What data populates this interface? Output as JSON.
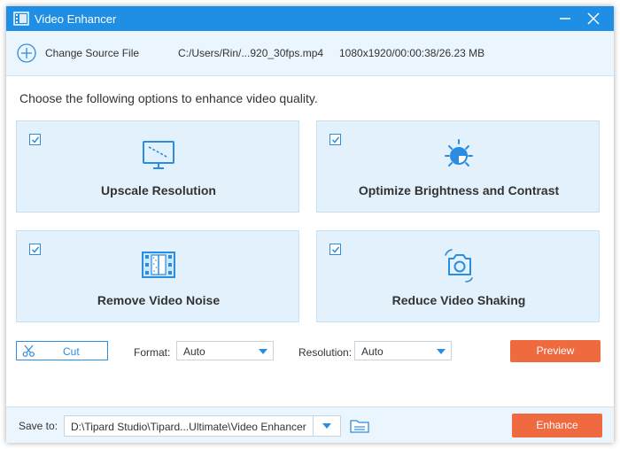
{
  "window": {
    "title": "Video Enhancer",
    "icons": {
      "app": "film-strip-icon",
      "minimize": "minimize-icon",
      "close": "close-icon"
    }
  },
  "source": {
    "change_label": "Change Source File",
    "path": "C:/Users/Rin/...920_30fps.mp4",
    "info": "1080x1920/00:00:38/26.23 MB",
    "icon": "plus-circle-icon"
  },
  "prompt": "Choose the following options to enhance video quality.",
  "options": [
    {
      "label": "Upscale Resolution",
      "checked": true,
      "icon": "monitor-icon"
    },
    {
      "label": "Optimize Brightness and Contrast",
      "checked": true,
      "icon": "brightness-icon"
    },
    {
      "label": "Remove Video Noise",
      "checked": true,
      "icon": "film-denoise-icon"
    },
    {
      "label": "Reduce Video Shaking",
      "checked": true,
      "icon": "camera-shake-icon"
    }
  ],
  "controls": {
    "cut_label": "Cut",
    "format_label": "Format:",
    "format_value": "Auto",
    "resolution_label": "Resolution:",
    "resolution_value": "Auto",
    "preview_label": "Preview"
  },
  "save": {
    "label": "Save to:",
    "path": "D:\\Tipard Studio\\Tipard...Ultimate\\Video Enhancer",
    "enhance_label": "Enhance"
  },
  "colors": {
    "titlebar": "#1f8fe5",
    "accent": "#2a8de0",
    "card_bg": "#e3f1fc",
    "action": "#ef6a3f",
    "bar_bg": "#eaf5fd"
  }
}
